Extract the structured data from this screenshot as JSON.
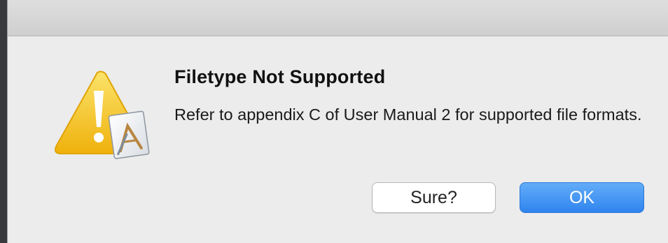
{
  "dialog": {
    "title": "Filetype Not Supported",
    "message": "Refer to appendix C of User Manual 2 for supported file formats.",
    "buttons": {
      "secondary_label": "Sure?",
      "primary_label": "OK"
    },
    "icon": "warning-triangle-with-app-badge-icon"
  },
  "colors": {
    "dialog_bg": "#ececec",
    "primary_button": "#2f84ee",
    "warning_yellow": "#f4c418"
  }
}
